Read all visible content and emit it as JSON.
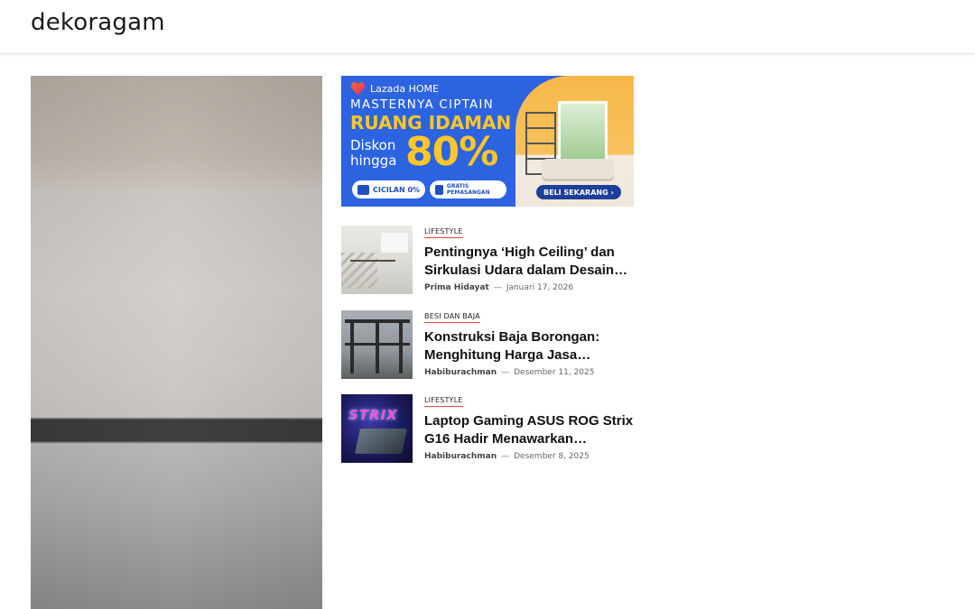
{
  "site": {
    "logo": "dekoragam"
  },
  "hero": {
    "image_desc": "interior-photo"
  },
  "ad": {
    "brand": "Lazada HOME",
    "line1": "MASTERNYA CIPTAIN",
    "line2": "RUANG IDAMAN",
    "line3": "Diskon hingga",
    "discount": "80%",
    "pill1": "CICILAN 0%",
    "pill2": "GRATIS PEMASANGAN",
    "cta": "BELI SEKARANG ›",
    "colors": {
      "bg": "#2c63e0",
      "accent": "#ffc629"
    }
  },
  "articles": [
    {
      "category": "LIFESTYLE",
      "title": "Pentingnya ‘High Ceiling’ dan Sirkulasi Udara dalam Desain…",
      "author": "Prima Hidayat",
      "date": "Januari 17, 2026"
    },
    {
      "category": "BESI DAN BAJA",
      "title": "Konstruksi Baja Borongan: Menghitung Harga Jasa…",
      "author": "Habiburachman",
      "date": "Desember 11, 2025"
    },
    {
      "category": "LIFESTYLE",
      "title": "Laptop Gaming ASUS ROG Strix G16 Hadir Menawarkan…",
      "author": "Habiburachman",
      "date": "Desember 8, 2025"
    }
  ],
  "meta_separator": "—",
  "thumb3_text": "STRIX",
  "colors": {
    "category_underline": "#e14b3a"
  }
}
